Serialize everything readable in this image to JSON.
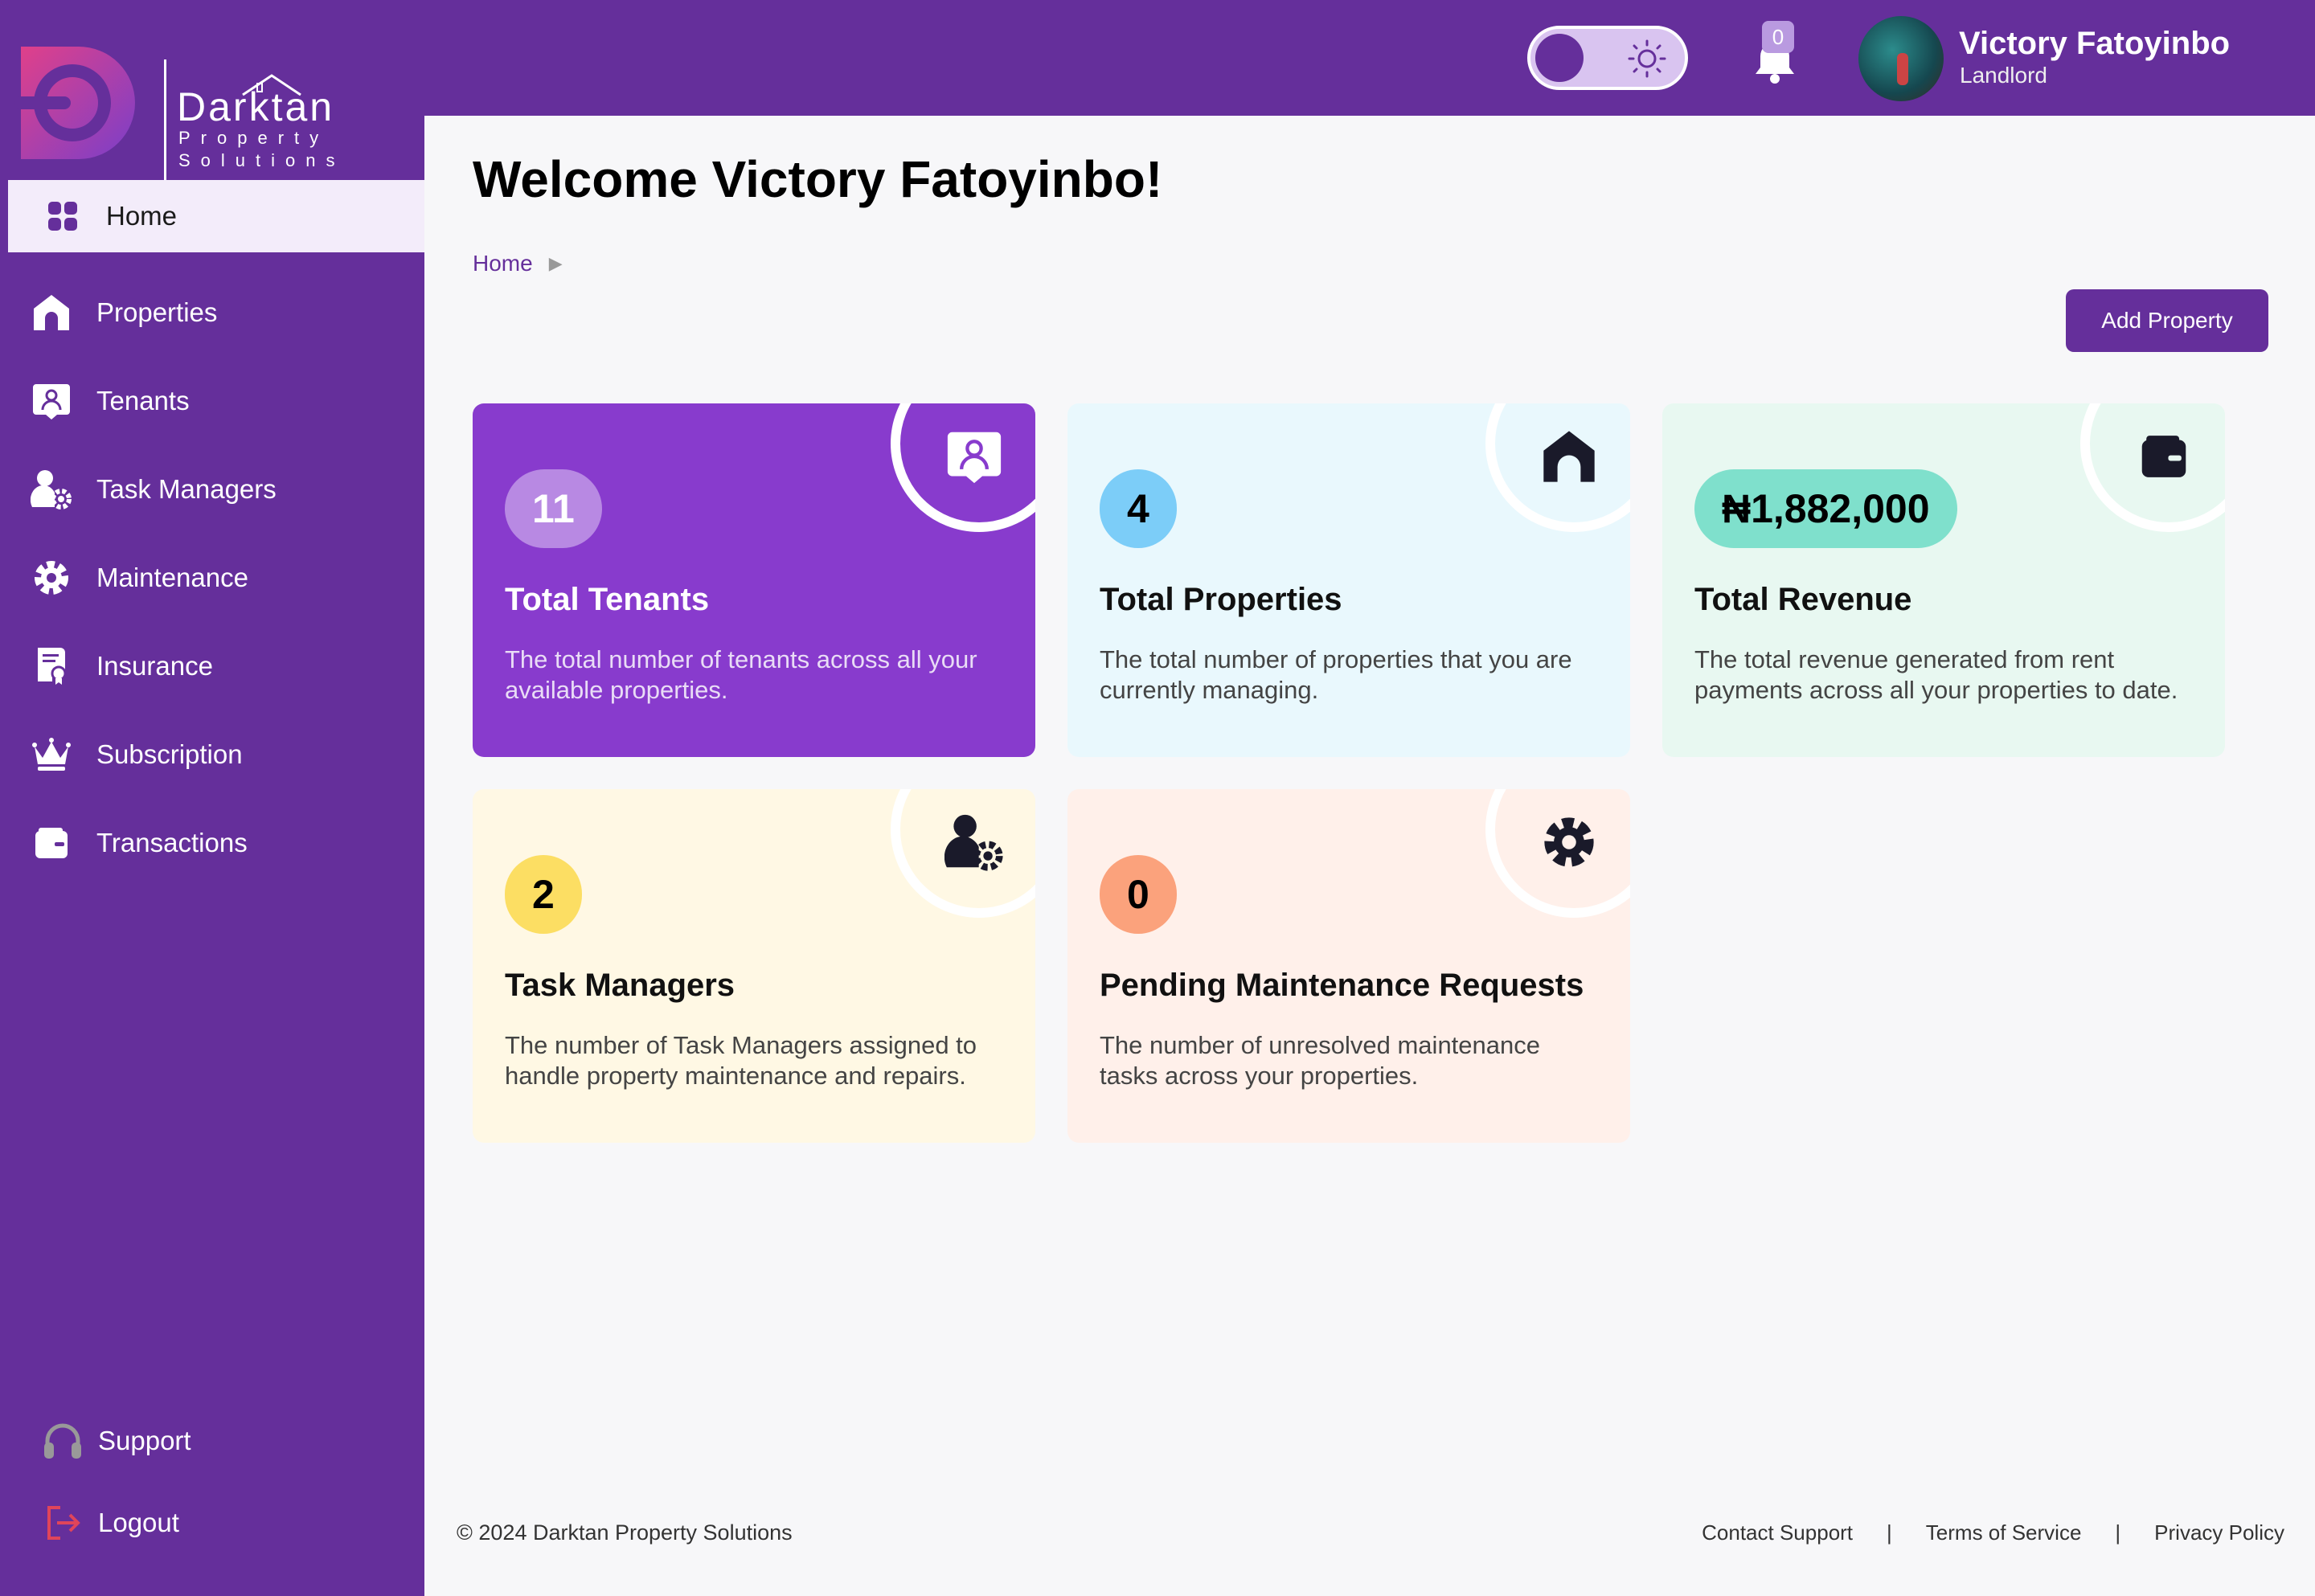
{
  "brand": {
    "name": "Darktan",
    "sub1": "Property",
    "sub2": "Solutions"
  },
  "header": {
    "notification_count": "0",
    "user_name": "Victory Fatoyinbo",
    "user_role": "Landlord"
  },
  "sidebar": {
    "items": [
      {
        "label": "Home",
        "icon": "grid-icon"
      },
      {
        "label": "Properties",
        "icon": "house-icon"
      },
      {
        "label": "Tenants",
        "icon": "tenant-badge-icon"
      },
      {
        "label": "Task Managers",
        "icon": "user-gear-icon"
      },
      {
        "label": "Maintenance",
        "icon": "gear-icon"
      },
      {
        "label": "Insurance",
        "icon": "certificate-icon"
      },
      {
        "label": "Subscription",
        "icon": "crown-icon"
      },
      {
        "label": "Transactions",
        "icon": "wallet-icon"
      }
    ],
    "bottom": [
      {
        "label": "Support",
        "icon": "headset-icon"
      },
      {
        "label": "Logout",
        "icon": "logout-icon"
      }
    ]
  },
  "main": {
    "welcome": "Welcome Victory Fatoyinbo!",
    "breadcrumb": "Home",
    "add_button": "Add Property"
  },
  "cards": [
    {
      "value": "11",
      "title": "Total Tenants",
      "desc": "The total number of tenants across all your available properties.",
      "icon": "tenant-badge-icon"
    },
    {
      "value": "4",
      "title": "Total Properties",
      "desc": "The total number of properties that you are currently managing.",
      "icon": "house-icon"
    },
    {
      "value": "₦1,882,000",
      "title": "Total Revenue",
      "desc": "The total revenue generated from rent payments across all your properties to date.",
      "icon": "wallet-icon"
    },
    {
      "value": "2",
      "title": "Task Managers",
      "desc": "The number of Task Managers assigned to handle property maintenance and repairs.",
      "icon": "user-gear-icon"
    },
    {
      "value": "0",
      "title": "Pending Maintenance Requests",
      "desc": "The number of unresolved maintenance tasks across your properties.",
      "icon": "gear-icon"
    }
  ],
  "footer": {
    "copyright": "© 2024 Darktan Property Solutions",
    "links": [
      "Contact Support",
      "Terms of Service",
      "Privacy Policy"
    ]
  },
  "colors": {
    "primary": "#652f9b",
    "card_purple": "#883bcd",
    "logout_red": "#e0455a"
  }
}
